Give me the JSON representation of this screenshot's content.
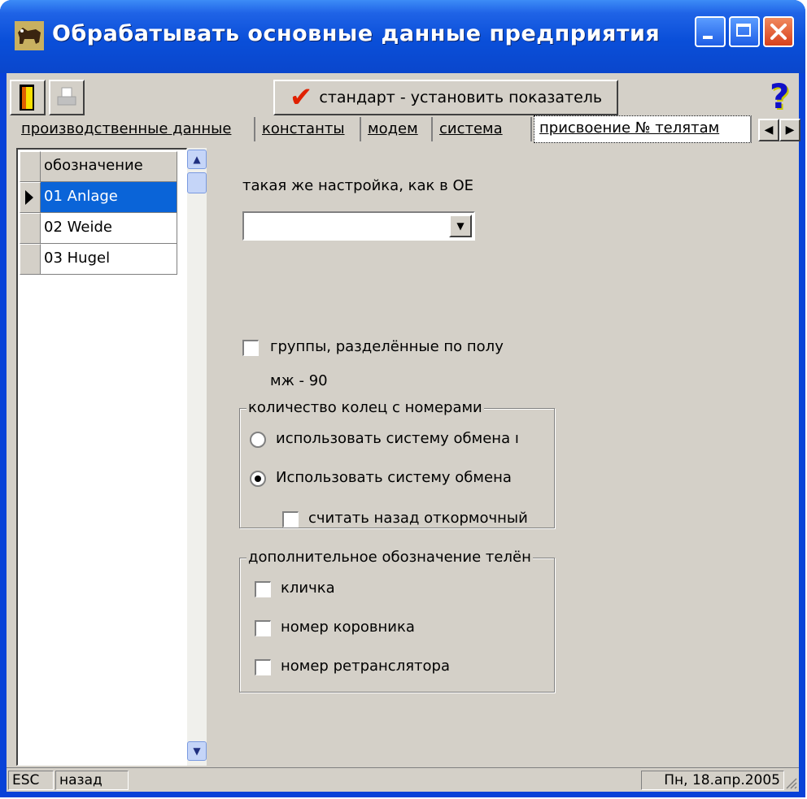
{
  "window": {
    "title": "Обрабатывать основные данные предприятия",
    "controls": [
      "minimize",
      "maximize",
      "close"
    ]
  },
  "toolbar": {
    "exit_icon": "door-exit-icon",
    "print_icon": "printer-icon",
    "standard_button_label": "стандарт - установить показатель",
    "help_icon": "help-question-icon"
  },
  "tabs": [
    {
      "label": "производственные данные",
      "active": false
    },
    {
      "label": "константы",
      "active": false
    },
    {
      "label": "модем",
      "active": false
    },
    {
      "label": "система",
      "active": false
    },
    {
      "label": "присвоение № телятам",
      "active": true
    }
  ],
  "grid": {
    "header": "обозначение",
    "rows": [
      {
        "label": "01 Anlage",
        "selected": true
      },
      {
        "label": "02 Weide",
        "selected": false
      },
      {
        "label": "03 Hugel",
        "selected": false
      }
    ]
  },
  "settings": {
    "same_setting_label": "такая же настройка, как в ОЕ",
    "same_setting_value": "",
    "sex_groups_label": "группы, разделённые по полу",
    "sex_groups_checked": false,
    "code_text": "мж - 90",
    "rings_group": {
      "title": "количество колец с номерами",
      "option1": "использовать систему обмена ı",
      "option2": "Использовать систему обмена",
      "selected": 2,
      "count_back_label": "считать назад откормочный",
      "count_back_checked": false
    },
    "extra_group": {
      "title": "дополнительное обозначение телён",
      "items": [
        {
          "label": "кличка",
          "checked": false
        },
        {
          "label": "номер коровника",
          "checked": false
        },
        {
          "label": "номер ретранслятора",
          "checked": false
        }
      ]
    }
  },
  "status": {
    "key": "ESC",
    "action": "назад",
    "date": "Пн, 18.апр.2005"
  }
}
